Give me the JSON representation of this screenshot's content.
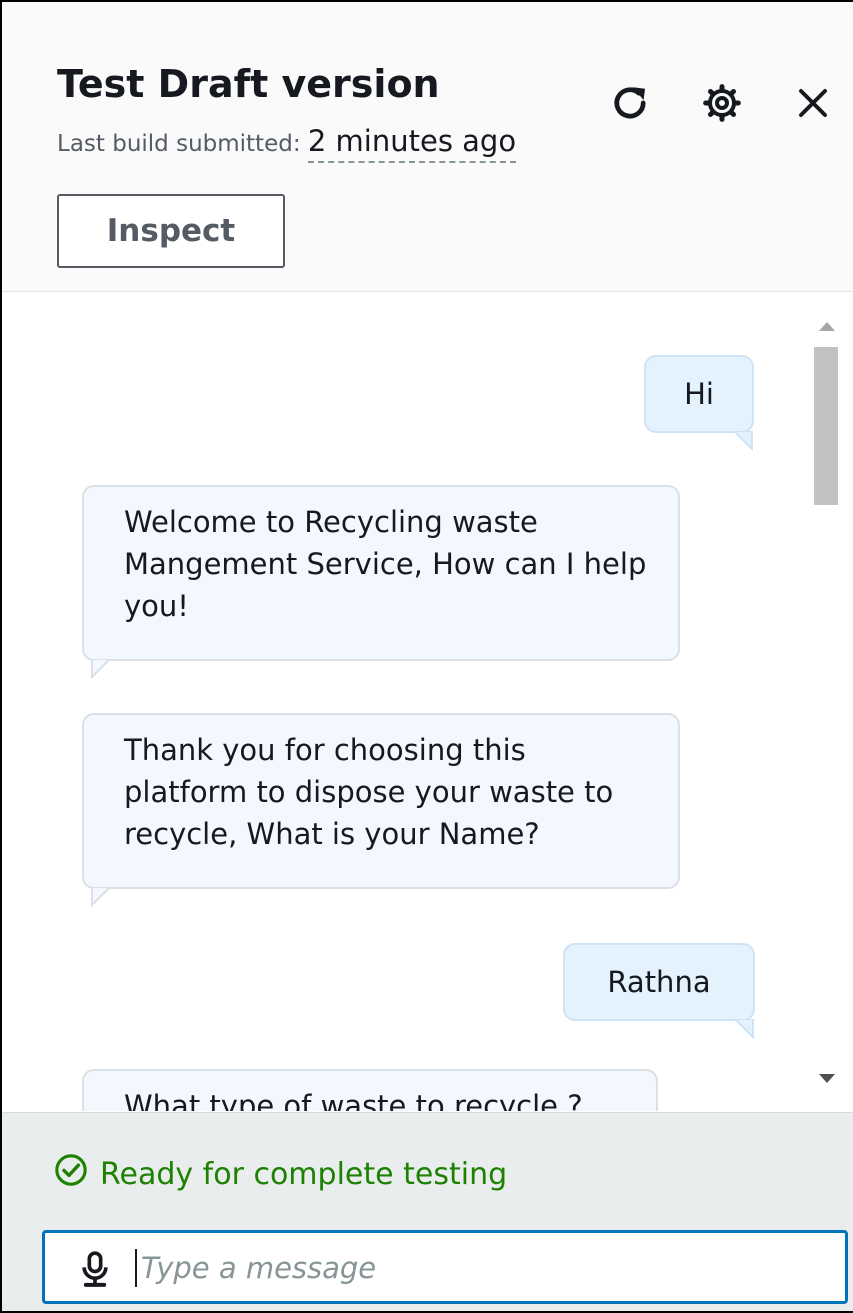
{
  "header": {
    "title": "Test Draft version",
    "subtitle_prefix": "Last build submitted:",
    "subtitle_time": "2 minutes ago",
    "inspect_label": "Inspect"
  },
  "chat": {
    "messages": [
      {
        "role": "user",
        "text": "Hi"
      },
      {
        "role": "bot",
        "text": "Welcome to Recycling waste Mangement Service, How can I help you!"
      },
      {
        "role": "bot",
        "text": "Thank you for choosing this platform to dispose your waste to recycle, What is your Name?"
      },
      {
        "role": "user",
        "text": "Rathna"
      },
      {
        "role": "bot",
        "text": "What type of waste to recycle ?"
      }
    ]
  },
  "footer": {
    "status": "Ready for complete testing",
    "input_placeholder": "Type a message",
    "input_value": ""
  },
  "colors": {
    "status_green": "#1d8102",
    "input_focus": "#0073bb",
    "user_bubble": "#e3f2fd",
    "bot_bubble": "#f2f8fd"
  },
  "icons": [
    "refresh-icon",
    "settings-icon",
    "close-icon",
    "microphone-icon",
    "check-circle-icon"
  ]
}
